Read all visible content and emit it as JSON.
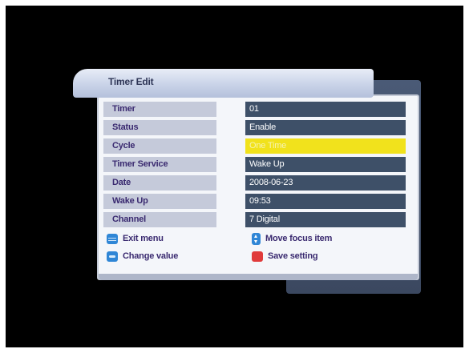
{
  "title": "Timer Edit",
  "rows": [
    {
      "label": "Timer",
      "value": "01"
    },
    {
      "label": "Status",
      "value": "Enable"
    },
    {
      "label": "Cycle",
      "value": "One Time"
    },
    {
      "label": "Timer Service",
      "value": "Wake Up"
    },
    {
      "label": "Date",
      "value": "2008-06-23"
    },
    {
      "label": "Wake Up",
      "value": "09:53"
    },
    {
      "label": "Channel",
      "value": "7 Digital"
    }
  ],
  "focused_row": "Cycle",
  "legend": {
    "exit": {
      "label": "Exit menu",
      "icon": "exit-menu-icon"
    },
    "move": {
      "label": "Move focus item",
      "icon": "up-down-icon"
    },
    "change": {
      "label": "Change value",
      "icon": "left-right-icon"
    },
    "save": {
      "label": "Save setting",
      "icon": "red-button-icon"
    }
  },
  "colors": {
    "focus_highlight": "#f1e21c",
    "value_background": "#3e5068",
    "label_background": "#c5cada",
    "legend_blue": "#2f86d6",
    "legend_red": "#e03b3b"
  }
}
